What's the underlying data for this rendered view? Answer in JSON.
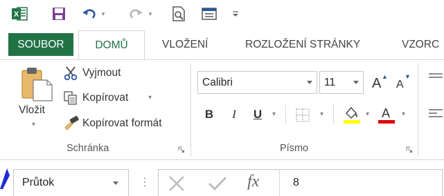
{
  "qat": {
    "app_icon": "excel-icon",
    "save_icon": "save-icon",
    "undo_icon": "undo-icon",
    "redo_icon": "redo-icon",
    "print_preview_icon": "print-preview-icon",
    "form_icon": "form-icon",
    "customize_icon": "customize-qat-icon"
  },
  "tabs": {
    "file": "SOUBOR",
    "home": "DOMŮ",
    "insert": "VLOŽENÍ",
    "page_layout": "ROZLOŽENÍ STRÁNKY",
    "formulas": "VZORC"
  },
  "clipboard": {
    "paste": "Vložit",
    "cut": "Vyjmout",
    "copy": "Kopírovat",
    "format_painter": "Kopírovat formát",
    "group_label": "Schránka"
  },
  "font": {
    "name": "Calibri",
    "size": "11",
    "bold": "B",
    "italic": "I",
    "underline": "U",
    "grow": "A",
    "shrink": "A",
    "color_letter": "A",
    "group_label": "Písmo",
    "highlight_color": "#ffff00",
    "font_color": "#e00000"
  },
  "formula_bar": {
    "name_box": "Průtok",
    "cancel_icon": "cancel-icon",
    "enter_icon": "check-icon",
    "fx": "fx",
    "value": "8"
  },
  "colors": {
    "accent": "#217346",
    "arrow": "#1f2bd8"
  }
}
